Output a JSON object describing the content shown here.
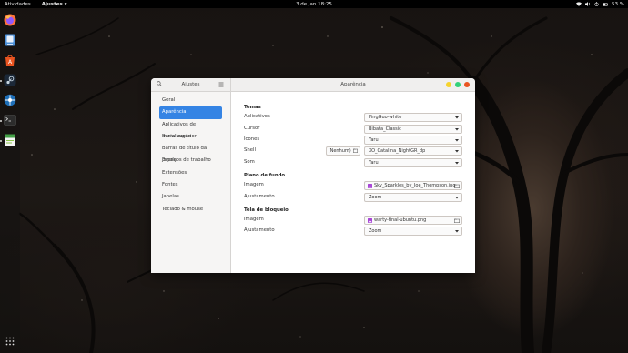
{
  "topbar": {
    "activities": "Atividades",
    "app_menu": "Ajustes",
    "clock": "3 de jan  18:25",
    "battery": "53 %"
  },
  "window": {
    "sidebar_title": "Ajustes",
    "page_title": "Aparência"
  },
  "sidebar": {
    "items": [
      {
        "label": "Geral"
      },
      {
        "label": "Aparência"
      },
      {
        "label": "Aplicativos de inicialização"
      },
      {
        "label": "Barra superior"
      },
      {
        "label": "Barras de título da janela"
      },
      {
        "label": "Espaços de trabalho"
      },
      {
        "label": "Extensões"
      },
      {
        "label": "Fontes"
      },
      {
        "label": "Janelas"
      },
      {
        "label": "Teclado & mouse"
      }
    ],
    "selected": "Aparência"
  },
  "themes": {
    "title": "Temas",
    "applications_label": "Aplicativos",
    "applications_value": "PingGuo-white",
    "cursor_label": "Cursor",
    "cursor_value": "Bibata_Classic",
    "icons_label": "Ícones",
    "icons_value": "Yaru",
    "shell_label": "Shell",
    "shell_none": "(Nenhum)",
    "shell_value": "XO_Catalina_NightGR_dp",
    "sound_label": "Som",
    "sound_value": "Yaru"
  },
  "background": {
    "title": "Plano de fundo",
    "image_label": "Imagem",
    "image_value": "Sky_Sparkles_by_Joe_Thompson.jpg",
    "adjust_label": "Ajustamento",
    "adjust_value": "Zoom"
  },
  "lockscreen": {
    "title": "Tela de bloqueio",
    "image_label": "Imagem",
    "image_value": "warty-final-ubuntu.png",
    "adjust_label": "Ajustamento",
    "adjust_value": "Zoom"
  },
  "colors": {
    "accent": "#3584e4",
    "close": "#e95420",
    "minimize": "#f6d32d",
    "maximize": "#33d17a"
  },
  "icons": {
    "dock": [
      "firefox-icon",
      "files-icon",
      "software-icon",
      "steam-icon",
      "network-icon",
      "terminal-icon",
      "office-icon",
      "apps-grid-icon"
    ],
    "tray": [
      "wifi-icon",
      "volume-icon",
      "power-icon",
      "battery-icon"
    ]
  }
}
